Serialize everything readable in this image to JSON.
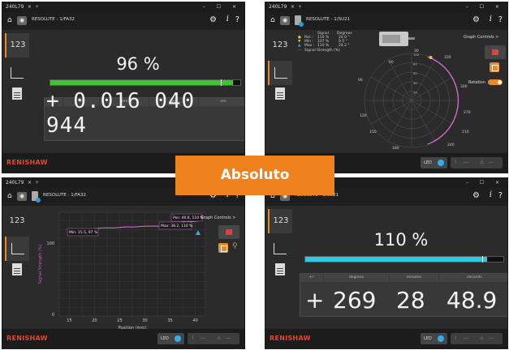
{
  "overlay_label": "Absoluto",
  "common": {
    "tab": "240L79",
    "tab_close": "×",
    "plus": "+",
    "window_controls": "– ☐ ×",
    "logo": "RENISHAW",
    "led_label": "LED",
    "status": [
      "!",
      "—",
      "⚠",
      "—"
    ],
    "nav_readout": "123"
  },
  "p1": {
    "title": "RESOLUTE - 1/FA32",
    "percent": "96 %",
    "fill_fraction": 0.96,
    "headers": [
      "+/-",
      "m",
      "mm",
      "µm",
      "nm"
    ],
    "value": "+ 0.016 040 944"
  },
  "p2": {
    "title": "RESOLUTE - 1/SU21",
    "legend_header": [
      "Signal",
      "Degrees"
    ],
    "legend_rows": [
      {
        "label": "Pos :",
        "signal": "110 %",
        "deg": "24.0 °"
      },
      {
        "label": "Min :",
        "signal": "107 %",
        "deg": "9.5 °"
      },
      {
        "label": "Max :",
        "signal": "110 %",
        "deg": "24.2 °"
      }
    ],
    "legend_line": "Signal Strength (%)",
    "graph_controls": "Graph Controls >",
    "rotation": "Rotation",
    "angles": [
      "30",
      "60",
      "90",
      "120",
      "150",
      "180",
      "210",
      "240",
      "330",
      "300",
      "270"
    ],
    "radial_marks": [
      "100",
      "80",
      "60",
      "40",
      "20"
    ]
  },
  "p3": {
    "title": "RESOLUTE - 1/FA32",
    "graph_controls": "Graph Controls >",
    "ylabel": "Signal Strength (%)",
    "xlabel": "Position (mm)",
    "yticks": [
      "100",
      "0"
    ],
    "xticks": [
      "15",
      "20",
      "25",
      "30",
      "35",
      "40"
    ],
    "ann_min": "Min: 15.5, 97 %",
    "ann_max": "Max: 38.2, 110 %",
    "ann_pos": "Pos: 40.6, 110 %"
  },
  "p4": {
    "title": "RESOLUTE - 1/SU21",
    "percent": "110 %",
    "fill_fraction": 0.92,
    "headers": [
      "+/-",
      "degrees",
      "minutes",
      "seconds"
    ],
    "value_sign": "+",
    "value_deg": "269",
    "value_min": "28",
    "value_sec": "48.9"
  }
}
